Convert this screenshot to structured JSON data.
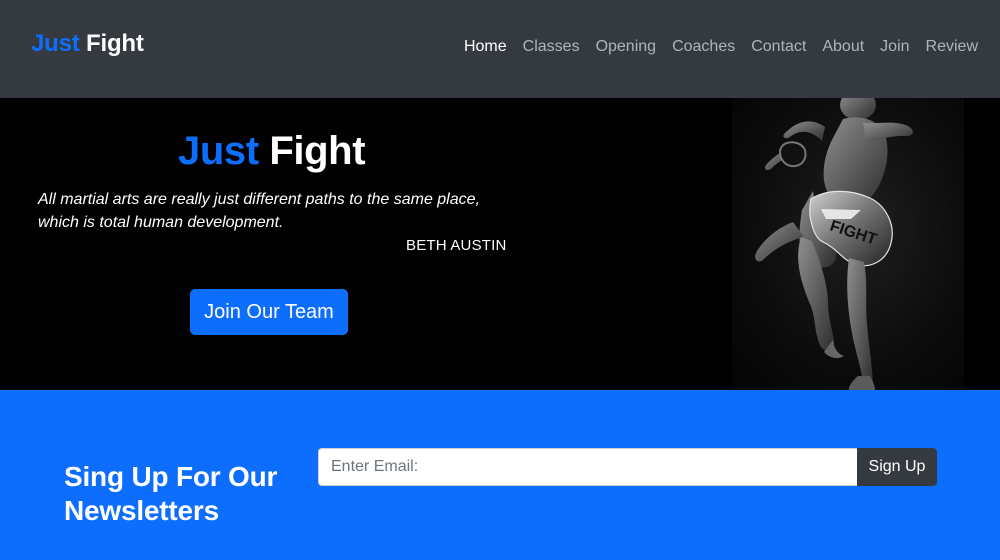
{
  "brand": {
    "part1": "Just",
    "part2": "Fight"
  },
  "nav": {
    "items": [
      {
        "label": "Home",
        "active": true
      },
      {
        "label": "Classes",
        "active": false
      },
      {
        "label": "Opening",
        "active": false
      },
      {
        "label": "Coaches",
        "active": false
      },
      {
        "label": "Contact",
        "active": false
      },
      {
        "label": "About",
        "active": false
      },
      {
        "label": "Join",
        "active": false
      },
      {
        "label": "Review",
        "active": false
      }
    ]
  },
  "hero": {
    "title_part1": "Just",
    "title_part2": "Fight",
    "quote": "All martial arts are really just different paths to the same place, which is total human development.",
    "author": "BETH AUSTIN",
    "cta_label": "Join Our Team"
  },
  "newsletter": {
    "title": "Sing Up For Our Newsletters",
    "email_placeholder": "Enter Email:",
    "email_value": "",
    "button_label": "Sign Up"
  },
  "colors": {
    "brand_blue": "#0d6efd",
    "nav_bg": "#343a40",
    "hero_bg": "#000000",
    "newsletter_bg": "#0d6efd",
    "button_dark": "#343a40"
  },
  "icons": {
    "hero_image": "martial-artist-kick-image"
  }
}
